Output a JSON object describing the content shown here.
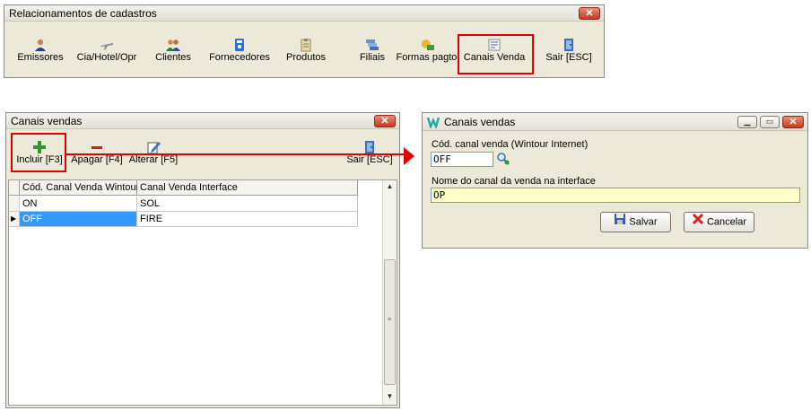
{
  "main_window": {
    "title": "Relacionamentos de cadastros",
    "toolbar": [
      {
        "label": "Emissores",
        "icon": "user-icon"
      },
      {
        "label": "Cia/Hotel/Opr",
        "icon": "airplane-icon"
      },
      {
        "label": "Clientes",
        "icon": "users-icon"
      },
      {
        "label": "Fornecedores",
        "icon": "phone-book-icon"
      },
      {
        "label": "Produtos",
        "icon": "clipboard-icon"
      },
      {
        "label": "Filiais",
        "icon": "stack-icon"
      },
      {
        "label": "Formas pagto.",
        "icon": "payment-icon"
      },
      {
        "label": "Canais Venda",
        "icon": "list-icon"
      },
      {
        "label": "Sair [ESC]",
        "icon": "exit-door-icon"
      }
    ]
  },
  "list_window": {
    "title": "Canais vendas",
    "toolbar": {
      "add": "Incluir [F3]",
      "delete": "Apagar [F4]",
      "edit": "Alterar [F5]",
      "exit": "Sair [ESC]"
    },
    "grid": {
      "columns": [
        "Cód. Canal Venda Wintour",
        "Canal Venda Interface"
      ],
      "rows": [
        [
          "ON",
          "SOL"
        ],
        [
          "OFF",
          "FIRE"
        ]
      ]
    }
  },
  "edit_window": {
    "title": "Canais vendas",
    "code_label": "Cód. canal venda (Wintour Internet)",
    "code_value": "OFF",
    "name_label": "Nome do canal da venda na interface",
    "name_value": "OP",
    "save": "Salvar",
    "cancel": "Cancelar"
  },
  "colors": {
    "highlight": "#e00000",
    "selection": "#3399ff"
  }
}
